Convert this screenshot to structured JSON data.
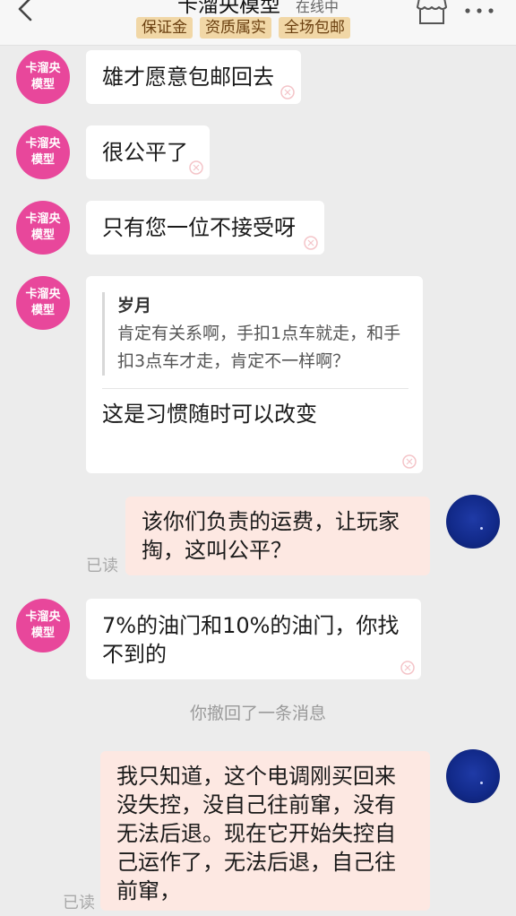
{
  "header": {
    "shop_name": "卡溜央模型",
    "status": "在线中",
    "badges": [
      "保证金",
      "资质属实",
      "全场包邮"
    ]
  },
  "shop_avatar": {
    "line1": "卡溜央",
    "line2": "模型"
  },
  "messages": [
    {
      "from": "shop",
      "text": "雄才愿意包邮回去"
    },
    {
      "from": "shop",
      "text": "很公平了"
    },
    {
      "from": "shop",
      "text": "只有您一位不接受呀"
    },
    {
      "from": "shop",
      "quote_name": "岁月",
      "quote_text": "肯定有关系啊，手扣1点车就走，和手扣3点车才走，肯定不一样啊？",
      "text": "这是习惯随时可以改变"
    },
    {
      "from": "me",
      "text": "该你们负责的运费，让玩家掏，这叫公平？",
      "read": "已读"
    },
    {
      "from": "shop",
      "text": "7%的油门和10%的油门，你找不到的"
    },
    {
      "from": "me",
      "text": "我只知道，这个电调刚买回来没失控，没自己往前窜，没有无法后退。现在它开始失控自己运作了，无法后退，自己往前窜，",
      "read": "已读"
    }
  ],
  "system": {
    "recall_notice": "你撤回了一条消息"
  },
  "colors": {
    "shop_avatar": "#e8479b",
    "badge_bg": "#f1d7a6",
    "my_bubble": "#fde8e2",
    "my_avatar": "#122a8a"
  },
  "icons": [
    "back-arrow-icon",
    "shop-icon",
    "more-icon",
    "watermark-icon"
  ]
}
